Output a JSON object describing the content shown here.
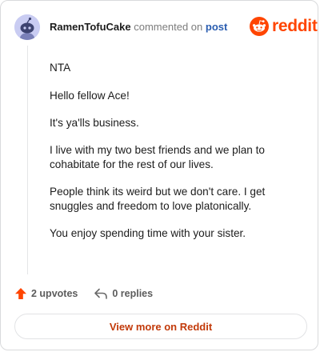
{
  "header": {
    "username": "RamenTofuCake",
    "commented_text": "commented on",
    "post_link": "post",
    "brand": "reddit"
  },
  "comment": {
    "paragraphs": [
      "NTA",
      "Hello fellow Ace!",
      "It's ya'lls business.",
      "I live with my two best friends and we plan to cohabitate for the rest of our lives.",
      "People think its weird but we don't care. I get snuggles and freedom to love platonically.",
      "You enjoy spending time with your sister."
    ]
  },
  "actions": {
    "upvotes": "2 upvotes",
    "replies": "0 replies"
  },
  "footer": {
    "view_more": "View more on Reddit"
  },
  "colors": {
    "accent": "#ff4500",
    "link": "#2a5db0",
    "avatar_bg": "#c9ccf2"
  },
  "icons": {
    "avatar": "snoo-avatar-icon",
    "brand": "reddit-logo-icon",
    "upvote": "upvote-arrow-icon",
    "reply": "reply-icon"
  }
}
